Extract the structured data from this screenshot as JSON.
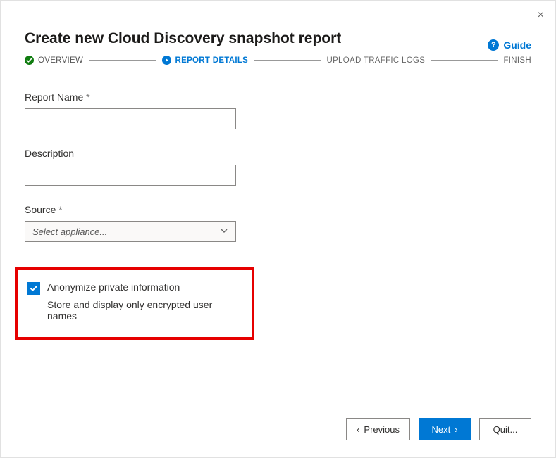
{
  "header": {
    "title": "Create new Cloud Discovery snapshot report",
    "guide_label": "Guide",
    "close_symbol": "×"
  },
  "stepper": {
    "steps": [
      {
        "label": "OVERVIEW",
        "state": "done"
      },
      {
        "label": "REPORT DETAILS",
        "state": "active"
      },
      {
        "label": "UPLOAD TRAFFIC LOGS",
        "state": "pending"
      },
      {
        "label": "FINISH",
        "state": "pending"
      }
    ]
  },
  "form": {
    "report_name": {
      "label": "Report Name",
      "required": true,
      "value": ""
    },
    "description": {
      "label": "Description",
      "required": false,
      "value": ""
    },
    "source": {
      "label": "Source",
      "required": true,
      "placeholder": "Select appliance..."
    },
    "anonymize": {
      "checked": true,
      "label": "Anonymize private information",
      "sublabel": "Store and display only encrypted user names"
    },
    "required_marker": "*"
  },
  "footer": {
    "previous": "Previous",
    "next": "Next",
    "quit": "Quit..."
  },
  "glyphs": {
    "prev_chevron": "‹",
    "next_chevron": "›",
    "help": "?"
  }
}
